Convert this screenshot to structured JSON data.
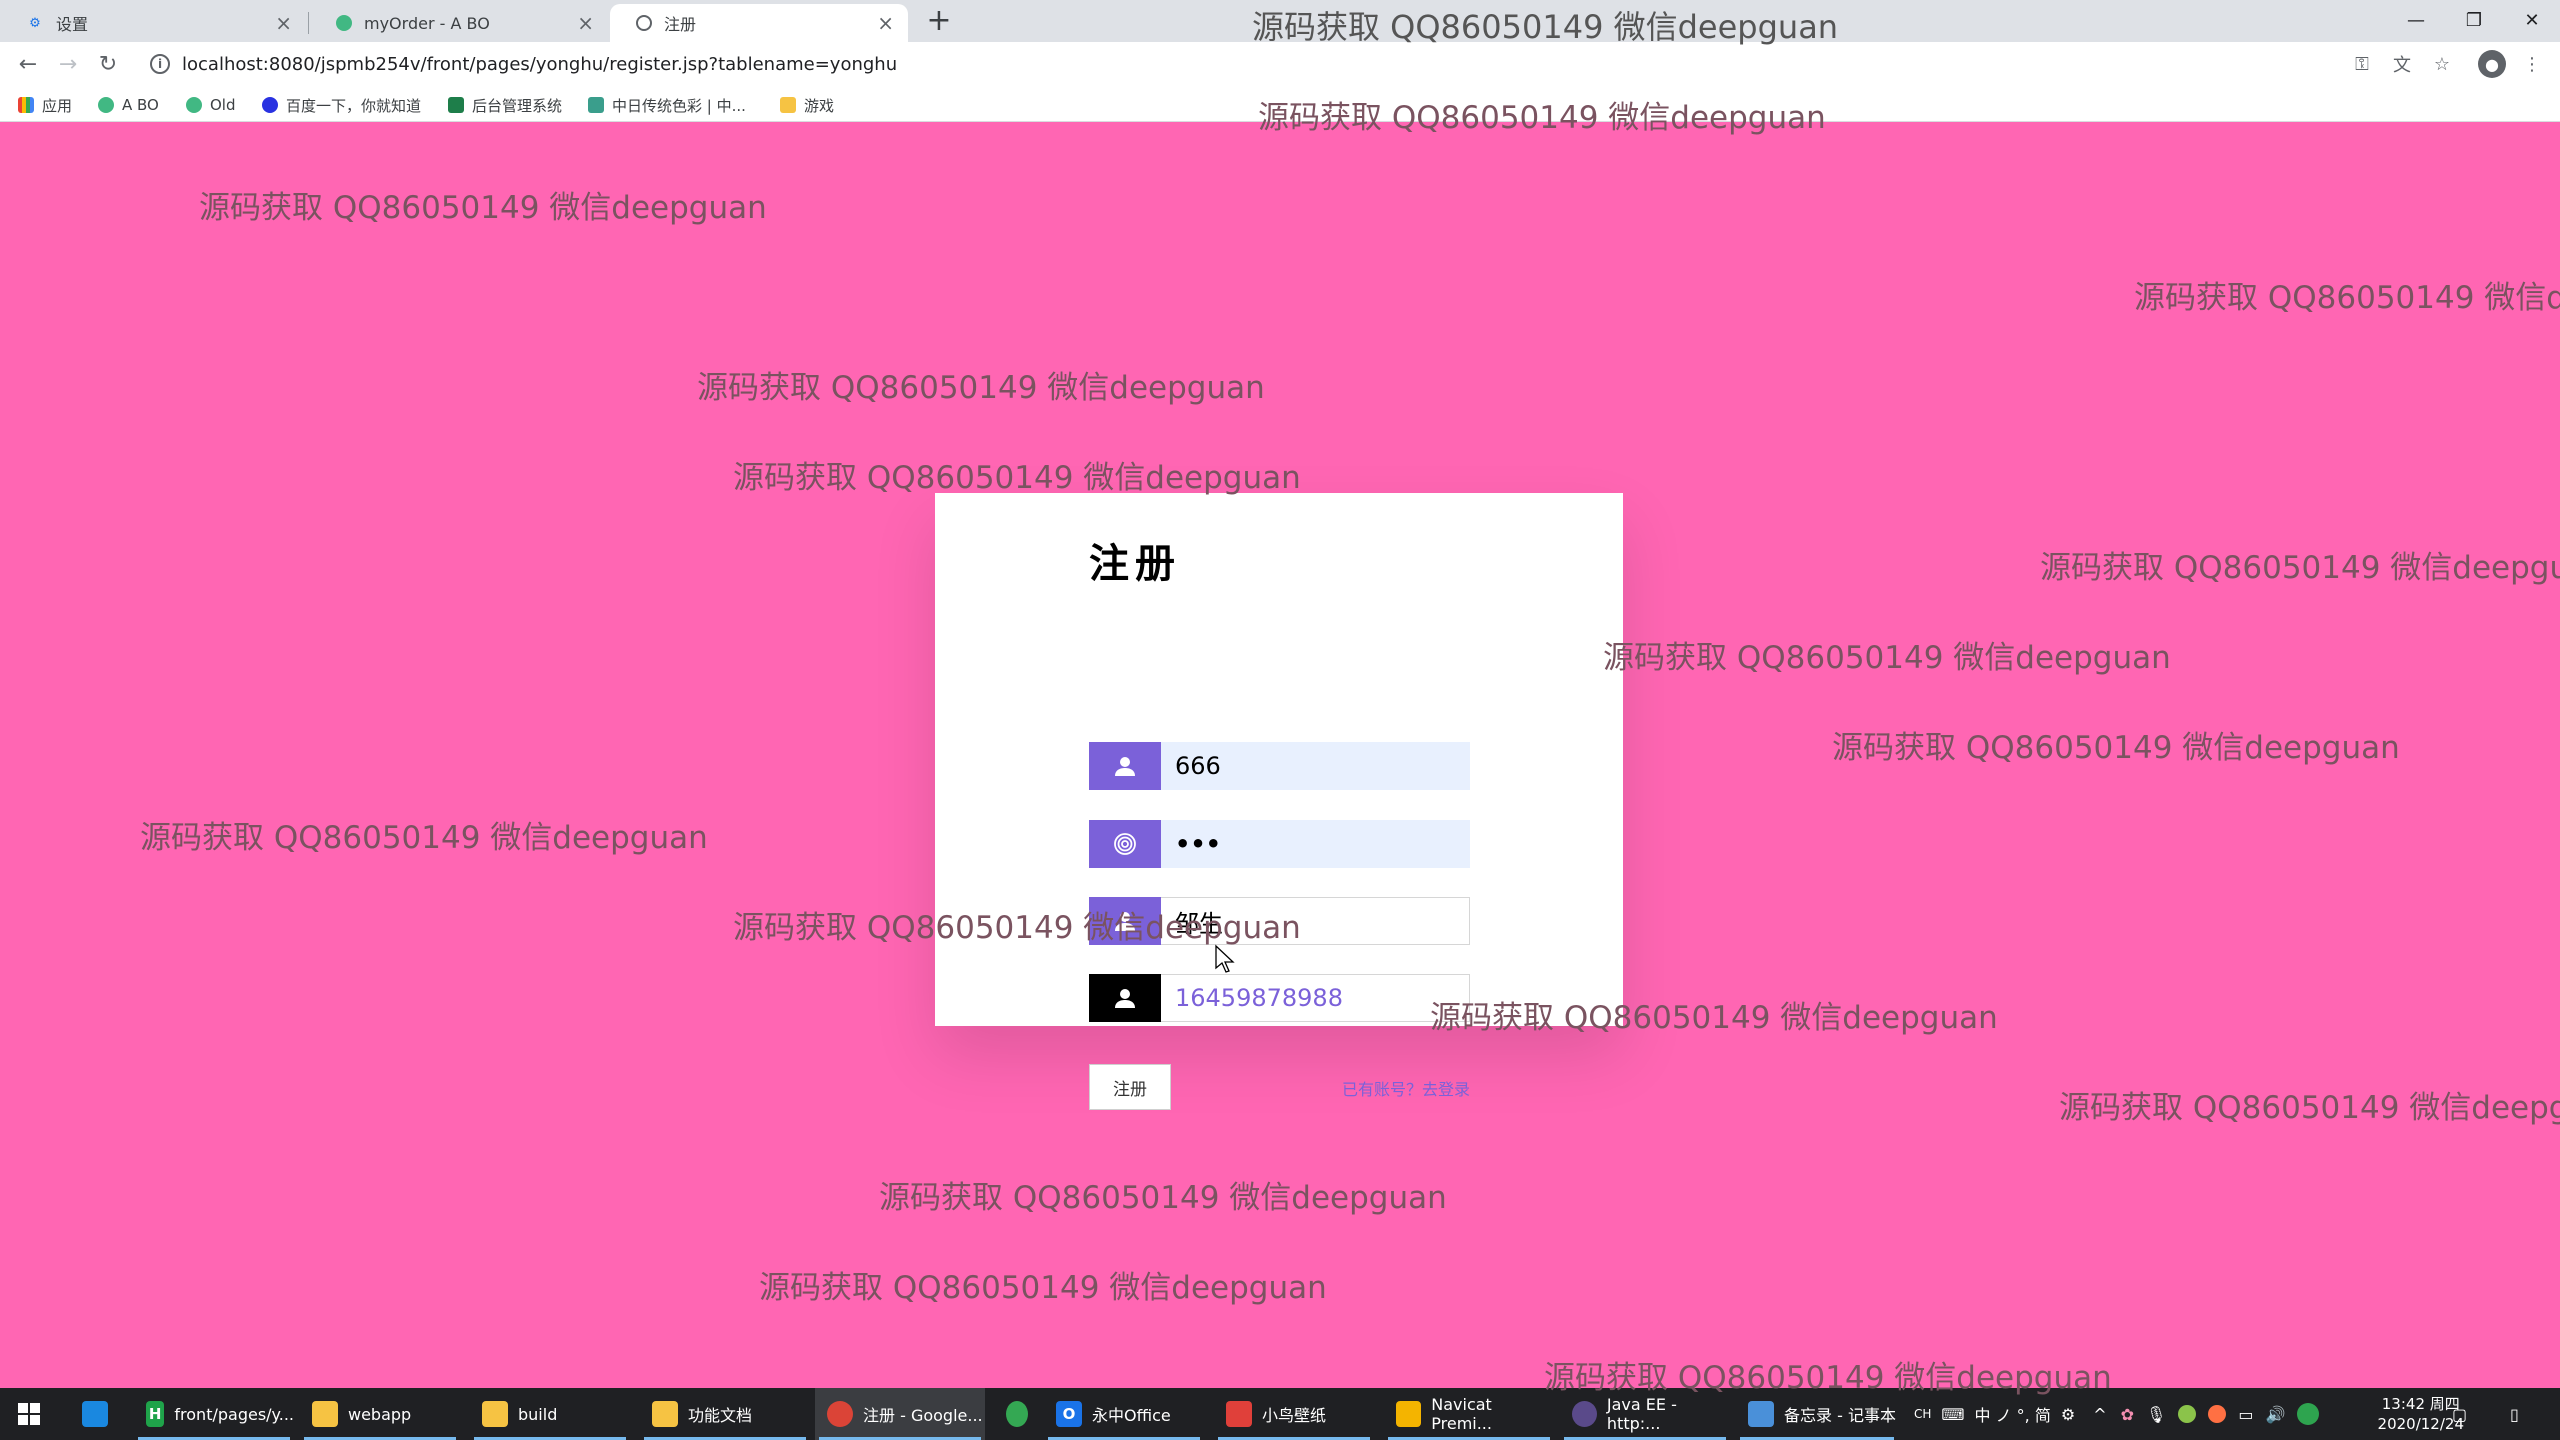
{
  "browser": {
    "tabs": [
      {
        "title": "设置",
        "icon": "gear-icon"
      },
      {
        "title": "myOrder - A BO",
        "icon": "vue-icon"
      },
      {
        "title": "注册",
        "icon": "globe-icon"
      }
    ],
    "url": "localhost:8080/jspmb254v/front/pages/yonghu/register.jsp?tablename=yonghu",
    "bookmarks": [
      "应用",
      "A BO",
      "Old",
      "百度一下，你就知道",
      "后台管理系统",
      "中日传统色彩 | 中...",
      "游戏"
    ]
  },
  "watermark_text": "源码获取 QQ86050149 微信deepguan",
  "form": {
    "title": "注册",
    "username_value": "666",
    "password_value": "•••",
    "name_value": "邹生",
    "phone_value": "16459878988",
    "submit_label": "注册",
    "login_link": "已有账号？去登录"
  },
  "taskbar": {
    "items": [
      {
        "label": "front/pages/y...",
        "icon": "hbuilder-icon",
        "color": "#1fa34a"
      },
      {
        "label": "webapp",
        "icon": "folder-icon",
        "color": "#f6c343"
      },
      {
        "label": "build",
        "icon": "folder-icon",
        "color": "#f6c343"
      },
      {
        "label": "功能文档",
        "icon": "folder-icon",
        "color": "#f6c343"
      },
      {
        "label": "注册 - Google...",
        "icon": "chrome-icon",
        "color": "#db4437"
      },
      {
        "label": "",
        "icon": "green-app-icon",
        "color": "#34a853"
      },
      {
        "label": "永中Office",
        "icon": "office-icon",
        "color": "#1a73e8"
      },
      {
        "label": "小鸟壁纸",
        "icon": "bird-icon",
        "color": "#e0403a"
      },
      {
        "label": "Navicat Premi...",
        "icon": "navicat-icon",
        "color": "#f4b400"
      },
      {
        "label": "Java EE - http:...",
        "icon": "eclipse-icon",
        "color": "#5a4a8a"
      },
      {
        "label": "备忘录 - 记事本",
        "icon": "notepad-icon",
        "color": "#4a90d9"
      }
    ],
    "ime_text": "中 ノ °, 简",
    "time": "13:42 周四",
    "date": "2020/12/24"
  },
  "colors": {
    "page_bg": "#ff66b3",
    "accent": "#7b61d9"
  }
}
